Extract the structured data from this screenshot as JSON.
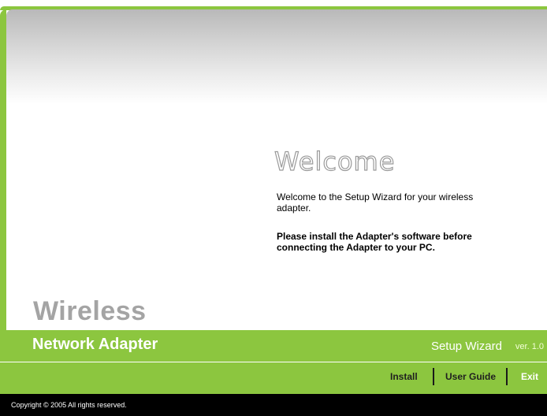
{
  "welcome": {
    "title": "Welcome",
    "line1": "Welcome to the Setup Wizard for your wireless adapter.",
    "line2": "Please install the Adapter's software before connecting the Adapter to your PC."
  },
  "product": {
    "line1": "Wireless",
    "line2": "Network Adapter"
  },
  "wizard": {
    "name": "Setup Wizard",
    "version": "ver. 1.0"
  },
  "nav": {
    "install": "Install",
    "user_guide": "User Guide",
    "exit": "Exit"
  },
  "footer": {
    "copyright": "Copyright © 2005 All rights reserved."
  },
  "colors": {
    "accent_green": "#8cc63f",
    "footer_black": "#000000",
    "product_grey": "#a4a4a4"
  }
}
